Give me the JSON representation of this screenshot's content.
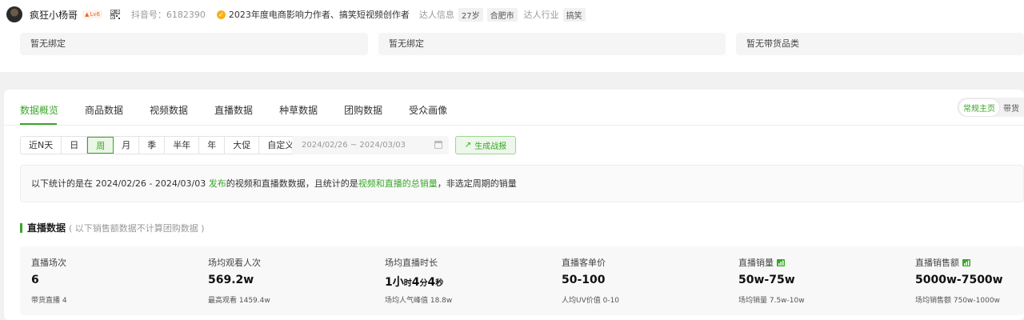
{
  "profile": {
    "name": "疯狂小杨哥",
    "level": "Lv6",
    "douyin_id": "抖音号：6182390",
    "verification": "2023年度电商影响力作者、搞笑短视频创作者",
    "info_label": "达人信息",
    "age": "27岁",
    "city": "合肥市",
    "industry_label": "达人行业",
    "industry": "搞笑"
  },
  "bind_cards": [
    "暂无绑定",
    "暂无绑定",
    "暂无带货品类"
  ],
  "tabs": [
    "数据概览",
    "商品数据",
    "视频数据",
    "直播数据",
    "种草数据",
    "团购数据",
    "受众画像"
  ],
  "mode_switch": [
    "常规主页",
    "带货"
  ],
  "periods": [
    "近N天",
    "日",
    "周",
    "月",
    "季",
    "半年",
    "年",
    "大促",
    "自定义"
  ],
  "date_range": "2024/02/26 ~ 2024/03/03",
  "report_button": "生成战报",
  "notice": {
    "prefix": "以下统计的是在 2024/02/26 - 2024/03/03 ",
    "publish": "发布",
    "middle": "的视频和直播数数据，且统计的是",
    "total": "视频和直播的总销量",
    "suffix": "，非选定周期的销量"
  },
  "section": {
    "title": "直播数据",
    "note": "( 以下销售额数据不计算团购数据 )"
  },
  "stats": [
    {
      "label": "直播场次",
      "value": "6",
      "sub": "带货直播 4",
      "icon": false
    },
    {
      "label": "场均观看人次",
      "value": "569.2w",
      "sub": "最高观看 1459.4w",
      "icon": false
    },
    {
      "label": "场均直播时长",
      "value_parts": [
        "1小",
        "时",
        "4",
        "分",
        "4",
        "秒"
      ],
      "sub": "场均人气峰值 18.8w",
      "icon": false
    },
    {
      "label": "直播客单价",
      "value": "50-100",
      "sub": "人均UV价值 0-10",
      "icon": false
    },
    {
      "label": "直播销量",
      "value": "50w-75w",
      "sub": "场均销量 7.5w-10w",
      "icon": true
    },
    {
      "label": "直播销售额",
      "value": "5000w-7500w",
      "sub": "场均销售额 750w-1000w",
      "icon": true
    }
  ],
  "colors": {
    "accent": "#3aa629",
    "verify": "#f5b21a",
    "level": "#e86a2b"
  }
}
